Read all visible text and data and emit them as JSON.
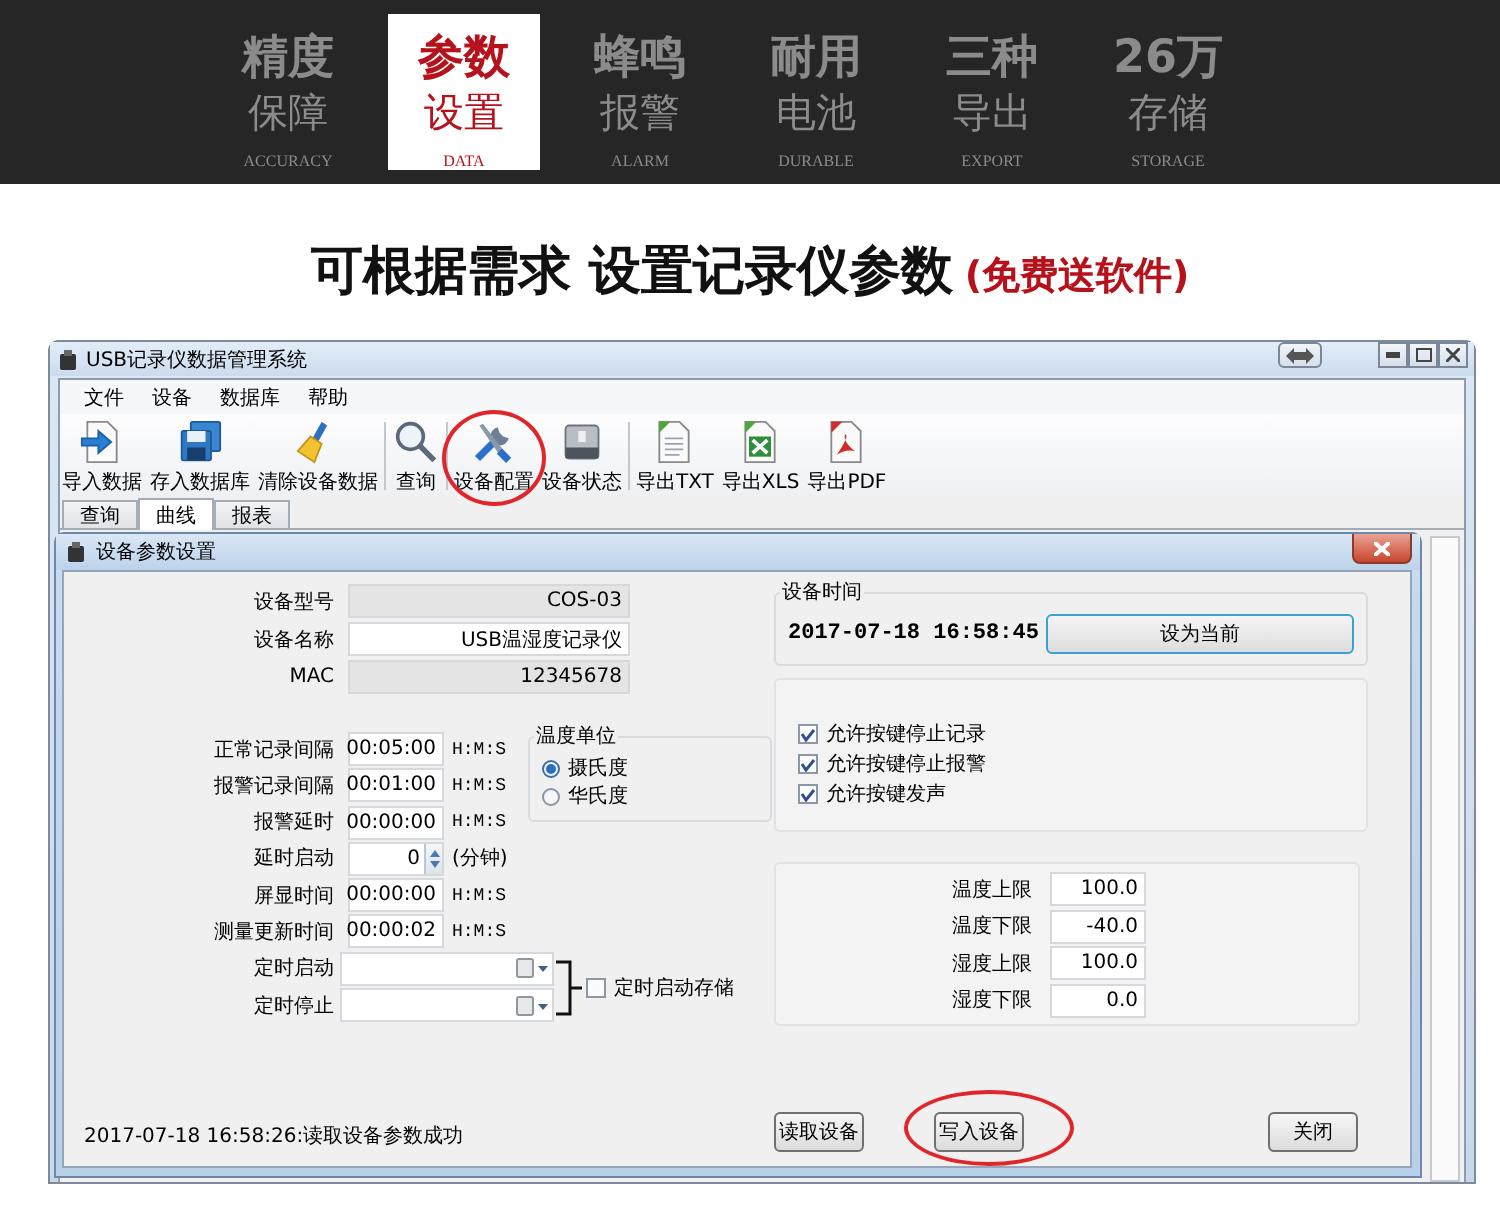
{
  "banner": [
    {
      "title": "精度",
      "subtitle": "保障",
      "caption": "ACCURACY",
      "selected": false
    },
    {
      "title": "参数",
      "subtitle": "设置",
      "caption": "DATA",
      "selected": true
    },
    {
      "title": "蜂鸣",
      "subtitle": "报警",
      "caption": "ALARM",
      "selected": false
    },
    {
      "title": "耐用",
      "subtitle": "电池",
      "caption": "DURABLE",
      "selected": false
    },
    {
      "title": "三种",
      "subtitle": "导出",
      "caption": "EXPORT",
      "selected": false
    },
    {
      "title": "26万",
      "subtitle": "存储",
      "caption": "STORAGE",
      "selected": false
    }
  ],
  "headline": {
    "text": "可根据需求 设置记录仪参数",
    "note": "(免费送软件)"
  },
  "window": {
    "title": "USB记录仪数据管理系统",
    "menu": [
      "文件",
      "设备",
      "数据库",
      "帮助"
    ],
    "toolbar_groups": [
      {
        "items": [
          {
            "label": "导入数据",
            "highlighted": false
          },
          {
            "label": "存入数据库",
            "highlighted": false
          },
          {
            "label": "清除设备数据",
            "highlighted": false
          }
        ]
      },
      {
        "items": [
          {
            "label": "查询",
            "highlighted": false
          }
        ]
      },
      {
        "items": [
          {
            "label": "设备配置",
            "highlighted": true
          },
          {
            "label": "设备状态",
            "highlighted": false
          }
        ]
      },
      {
        "items": [
          {
            "label": "导出TXT",
            "highlighted": false
          },
          {
            "label": "导出XLS",
            "highlighted": false
          },
          {
            "label": "导出PDF",
            "highlighted": false
          }
        ]
      }
    ],
    "tabs": [
      {
        "label": "查询",
        "selected": false
      },
      {
        "label": "曲线",
        "selected": true
      },
      {
        "label": "报表",
        "selected": false
      }
    ]
  },
  "dialog": {
    "title": "设备参数设置",
    "device_fields": [
      {
        "label": "设备型号",
        "value": "COS-03",
        "readonly": true
      },
      {
        "label": "设备名称",
        "value": "USB温湿度记录仪",
        "readonly": false
      },
      {
        "label": "MAC",
        "value": "12345678",
        "readonly": true
      }
    ],
    "interval_fields": [
      {
        "kind": "time",
        "label": "正常记录间隔",
        "value": "00:05:00",
        "unit": "H:M:S"
      },
      {
        "kind": "time",
        "label": "报警记录间隔",
        "value": "00:01:00",
        "unit": "H:M:S"
      },
      {
        "kind": "time",
        "label": "报警延时",
        "value": "00:00:00",
        "unit": "H:M:S"
      },
      {
        "kind": "spin",
        "label": "延时启动",
        "value": "0",
        "unit": "(分钟)"
      },
      {
        "kind": "time",
        "label": "屏显时间",
        "value": "00:00:00",
        "unit": "H:M:S"
      },
      {
        "kind": "time",
        "label": "测量更新时间",
        "value": "00:00:02",
        "unit": "H:M:S"
      }
    ],
    "schedule": {
      "fields": [
        {
          "label": "定时启动"
        },
        {
          "label": "定时停止"
        }
      ],
      "checkbox": {
        "label": "定时启动存储",
        "checked": false
      }
    },
    "temperature_unit": {
      "title": "温度单位",
      "options": [
        {
          "label": "摄氏度",
          "selected": true
        },
        {
          "label": "华氏度",
          "selected": false
        }
      ]
    },
    "device_time": {
      "title": "设备时间",
      "value": "2017-07-18 16:58:45",
      "button": "设为当前"
    },
    "options": [
      {
        "label": "允许按键停止记录",
        "checked": true
      },
      {
        "label": "允许按键停止报警",
        "checked": true
      },
      {
        "label": "允许按键发声",
        "checked": true
      }
    ],
    "limits": [
      {
        "label": "温度上限",
        "value": "100.0"
      },
      {
        "label": "温度下限",
        "value": "-40.0"
      },
      {
        "label": "湿度上限",
        "value": "100.0"
      },
      {
        "label": "湿度下限",
        "value": "0.0"
      }
    ],
    "status": "2017-07-18 16:58:26:读取设备参数成功",
    "buttons": [
      {
        "label": "读取设备",
        "highlighted": false
      },
      {
        "label": "写入设备",
        "highlighted": true
      },
      {
        "label": "关闭",
        "highlighted": false
      }
    ]
  }
}
